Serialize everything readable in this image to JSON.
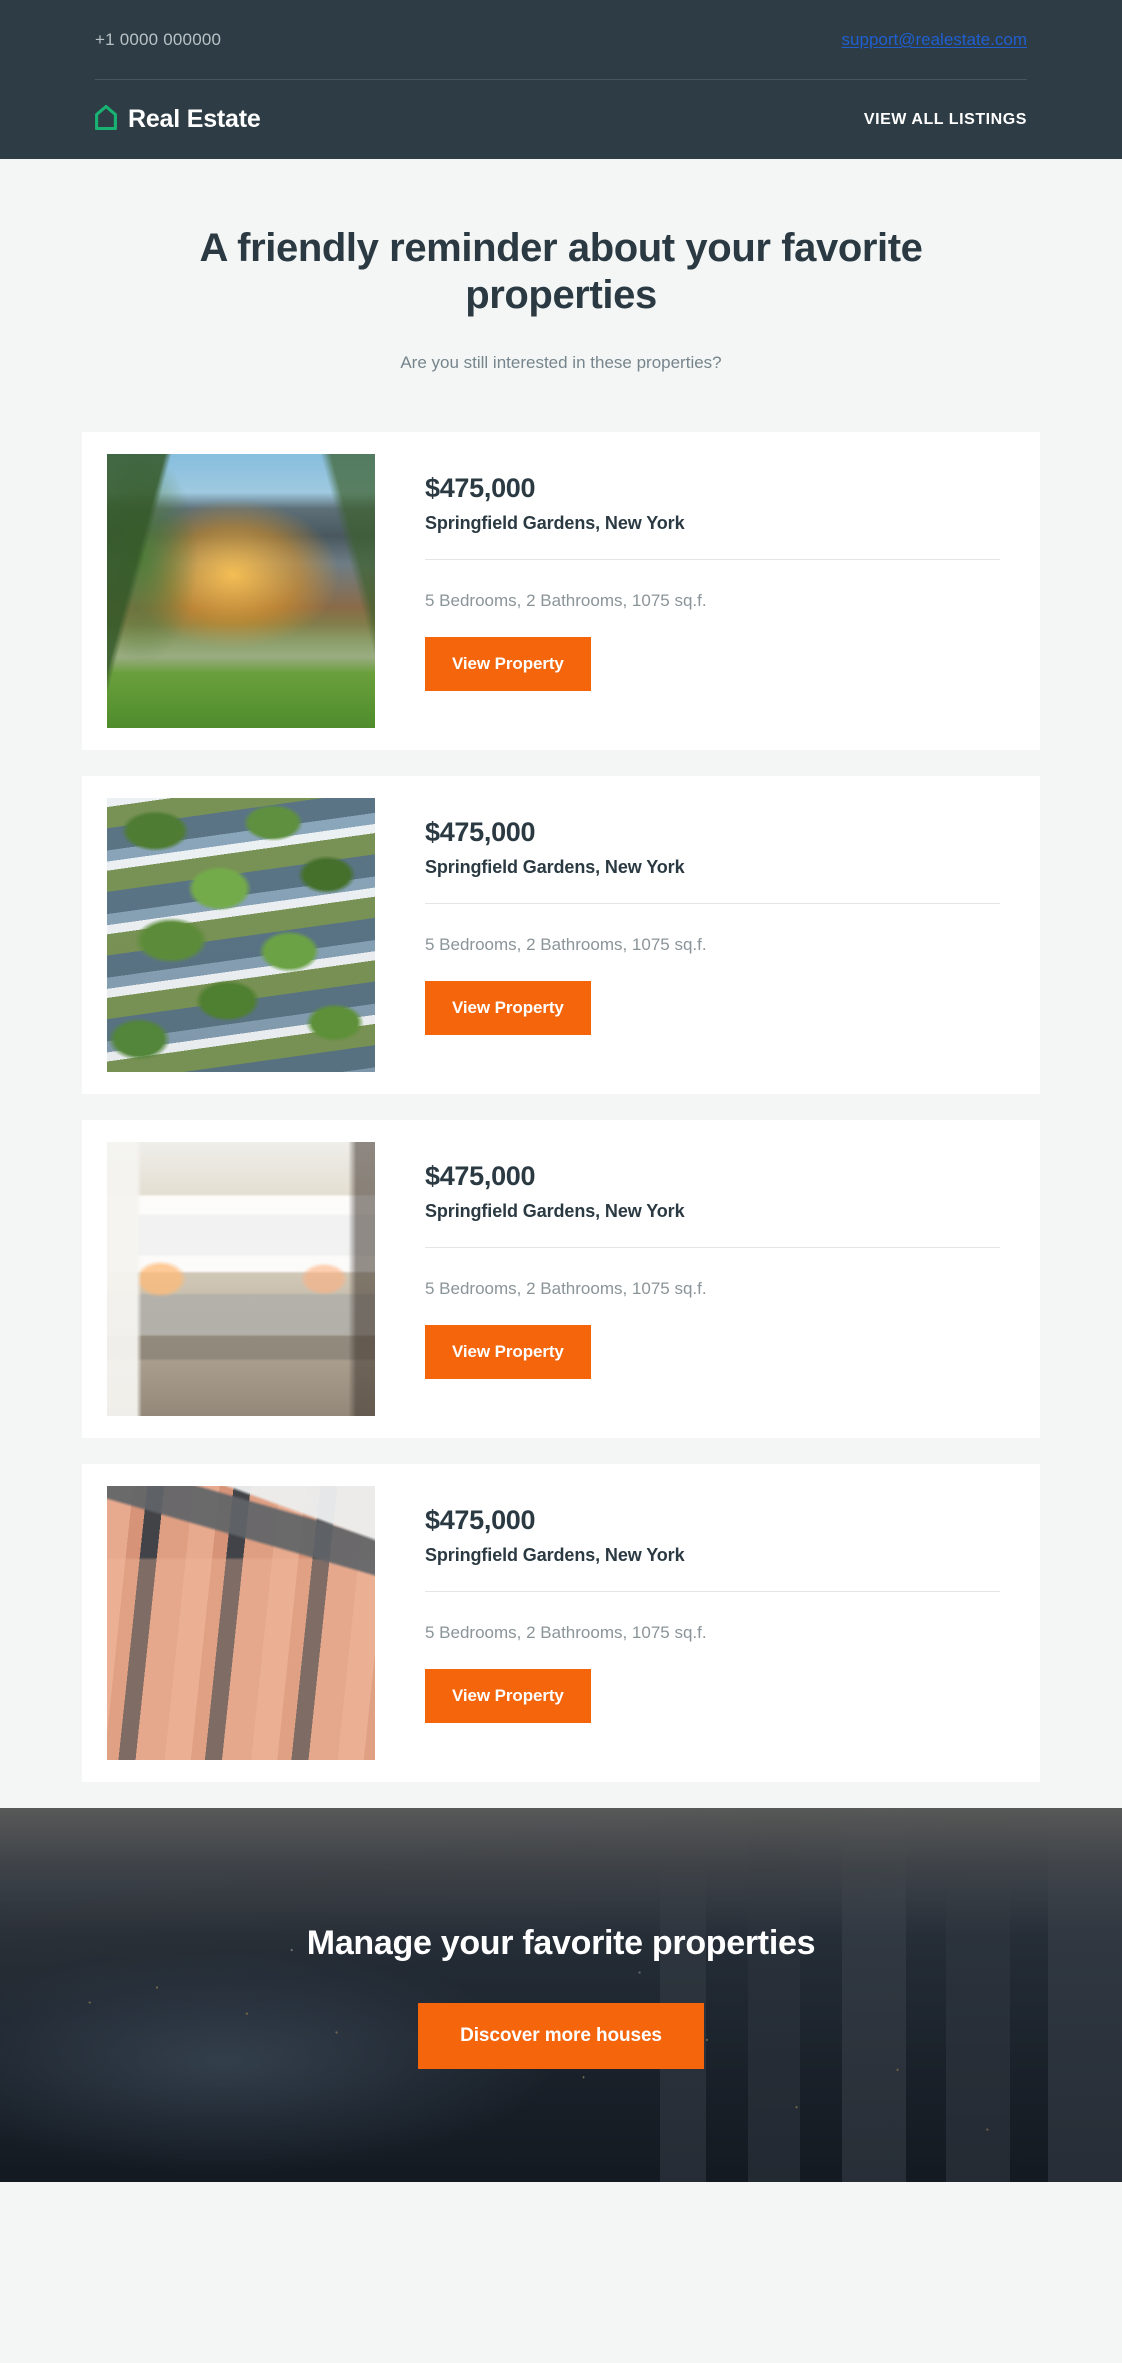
{
  "topbar": {
    "phone": "+1 0000 000000",
    "email": "support@realestate.com",
    "brand_name": "Real Estate",
    "brand_icon": "house-icon",
    "brand_icon_color": "#18b373",
    "view_all_label": "VIEW ALL LISTINGS"
  },
  "hero": {
    "title": "A friendly reminder about your favorite properties",
    "subtitle": "Are you still interested in these properties?"
  },
  "listings": [
    {
      "price": "$475,000",
      "address": "Springfield Gardens, New York",
      "specs": "5 Bedrooms, 2 Bathrooms, 1075 sq.f.",
      "cta_label": "View Property",
      "image_name": "property-photo-exterior-house-dusk"
    },
    {
      "price": "$475,000",
      "address": "Springfield Gardens, New York",
      "specs": "5 Bedrooms, 2 Bathrooms, 1075 sq.f.",
      "cta_label": "View Property",
      "image_name": "property-photo-vertical-forest-balconies"
    },
    {
      "price": "$475,000",
      "address": "Springfield Gardens, New York",
      "specs": "5 Bedrooms, 2 Bathrooms, 1075 sq.f.",
      "cta_label": "View Property",
      "image_name": "property-photo-modern-bedroom-interior"
    },
    {
      "price": "$475,000",
      "address": "Springfield Gardens, New York",
      "specs": "5 Bedrooms, 2 Bathrooms, 1075 sq.f.",
      "cta_label": "View Property",
      "image_name": "property-photo-classical-pink-facade"
    }
  ],
  "cta": {
    "heading": "Manage your favorite properties",
    "button_label": "Discover more houses",
    "background_image_name": "city-skyline-at-dusk"
  },
  "colors": {
    "header_dark": "#2e3d45",
    "page_background": "#f4f6f6",
    "card_background": "#ffffff",
    "accent_orange": "#f4650c",
    "brand_green": "#18b373",
    "link_blue": "#1f5fd0",
    "text_dark": "#2b3a42",
    "text_muted": "#8a9499"
  }
}
